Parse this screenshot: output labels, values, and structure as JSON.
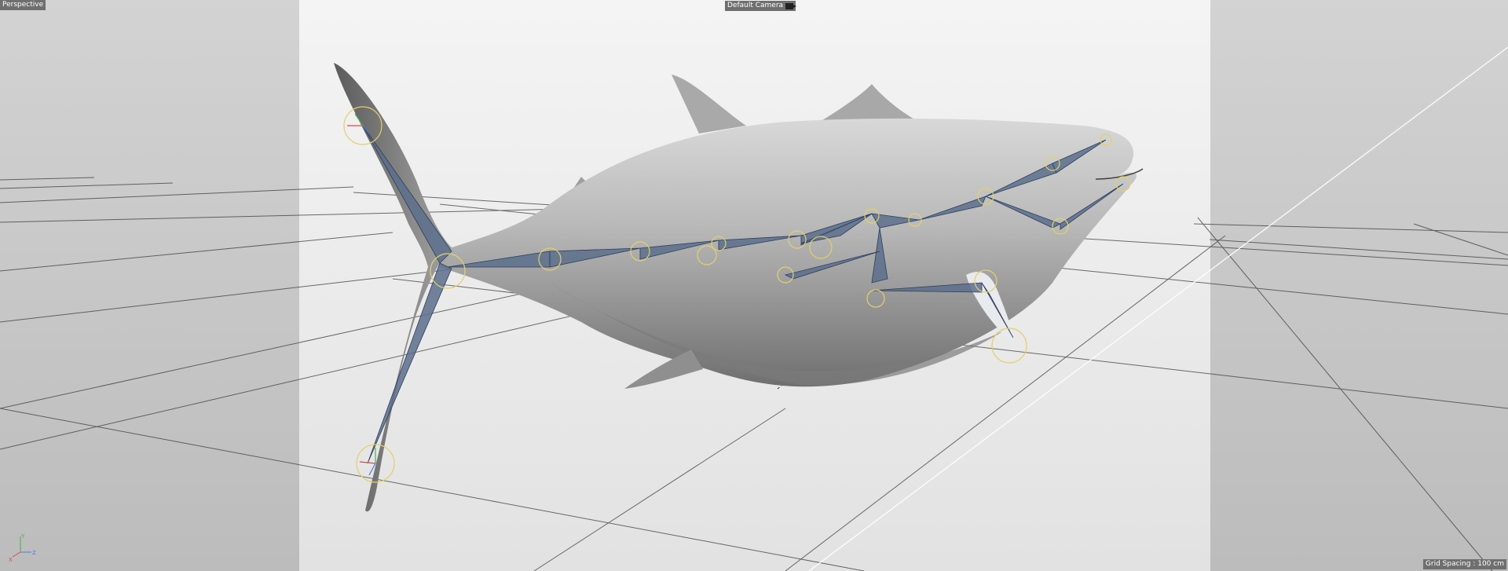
{
  "viewport": {
    "view_name": "Perspective",
    "camera_name": "Default Camera",
    "grid_spacing": "Grid Spacing : 100 cm"
  },
  "axis_gizmo": {
    "x": "X",
    "y": "Y",
    "z": "Z"
  },
  "icons": {
    "camera": "camera-icon"
  },
  "colors": {
    "bone_fill": "#5c6f8c",
    "joint_ring": "#e2d06a",
    "grid_line": "#3c3c3c",
    "axis_x": "#d84a4a",
    "axis_y": "#4cae4c",
    "axis_z": "#4a7ad8"
  }
}
